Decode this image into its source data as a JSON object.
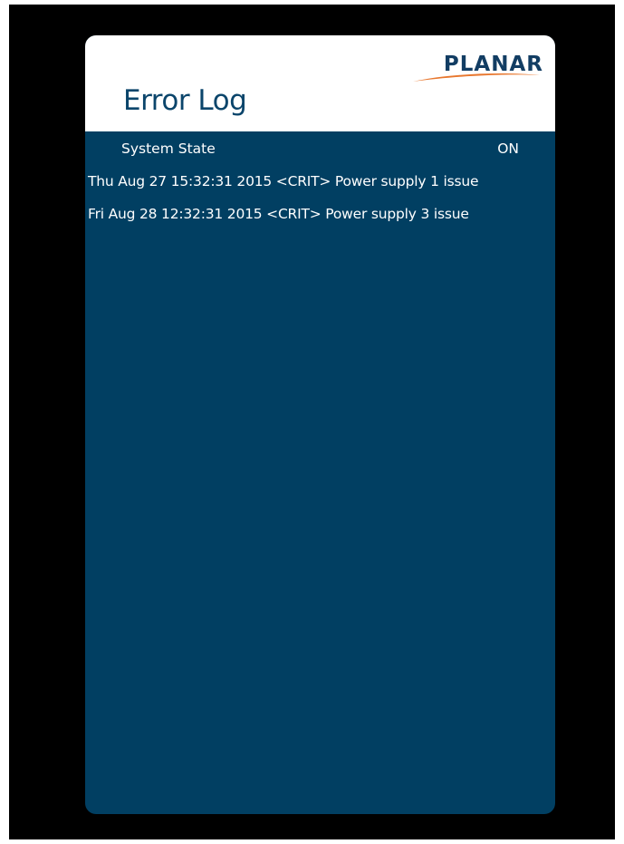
{
  "brand": {
    "logo_text": "PLANAR",
    "logo_color": "#123d63",
    "swoosh_color": "#e8772e"
  },
  "page": {
    "title": "Error Log"
  },
  "system_state": {
    "label": "System State",
    "value": "ON"
  },
  "log_entries": [
    "Thu Aug 27 15:32:31 2015 <CRIT> Power supply 1 issue",
    "Fri Aug 28 12:32:31 2015 <CRIT> Power supply 3 issue"
  ],
  "colors": {
    "panel_background": "#013f62",
    "header_background": "#ffffff",
    "title_color": "#0b456b",
    "text_color": "#ffffff",
    "frame_color": "#000000"
  }
}
